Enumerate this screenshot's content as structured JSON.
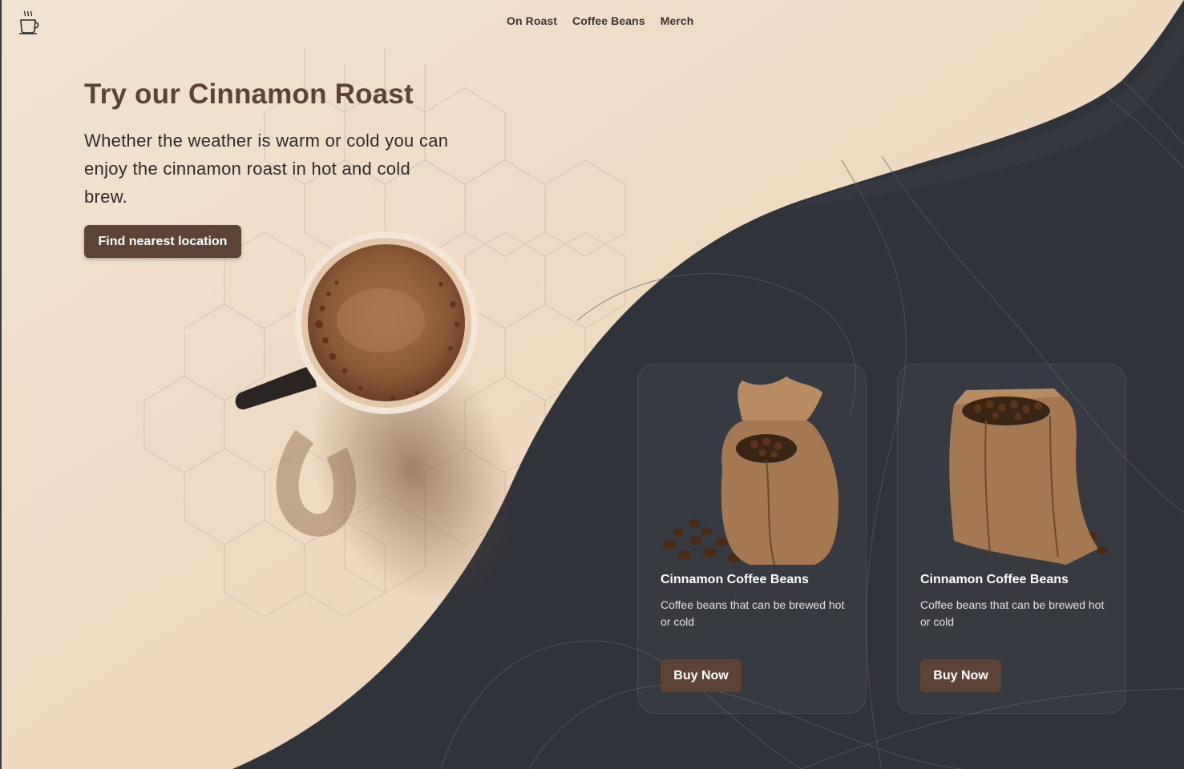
{
  "brand": {
    "logo_icon": "coffee-cup-icon"
  },
  "nav": {
    "items": [
      {
        "label": "On Roast"
      },
      {
        "label": "Coffee Beans"
      },
      {
        "label": "Merch"
      }
    ]
  },
  "hero": {
    "title": "Try our Cinnamon Roast",
    "text": "Whether the weather is warm or cold you can enjoy the cinnamon roast in hot and cold brew.",
    "cta_label": "Find nearest location"
  },
  "products": [
    {
      "title": "Cinnamon Coffee Beans",
      "description": "Coffee beans that can be brewed hot or cold",
      "button_label": "Buy Now"
    },
    {
      "title": "Cinnamon Coffee Beans",
      "description": "Coffee beans that can be brewed hot or cold",
      "button_label": "Buy Now"
    }
  ],
  "colors": {
    "cream": "#f0dcc5",
    "dark": "#31333b",
    "brand_brown": "#5d4336",
    "title_brown": "#5d4336"
  }
}
